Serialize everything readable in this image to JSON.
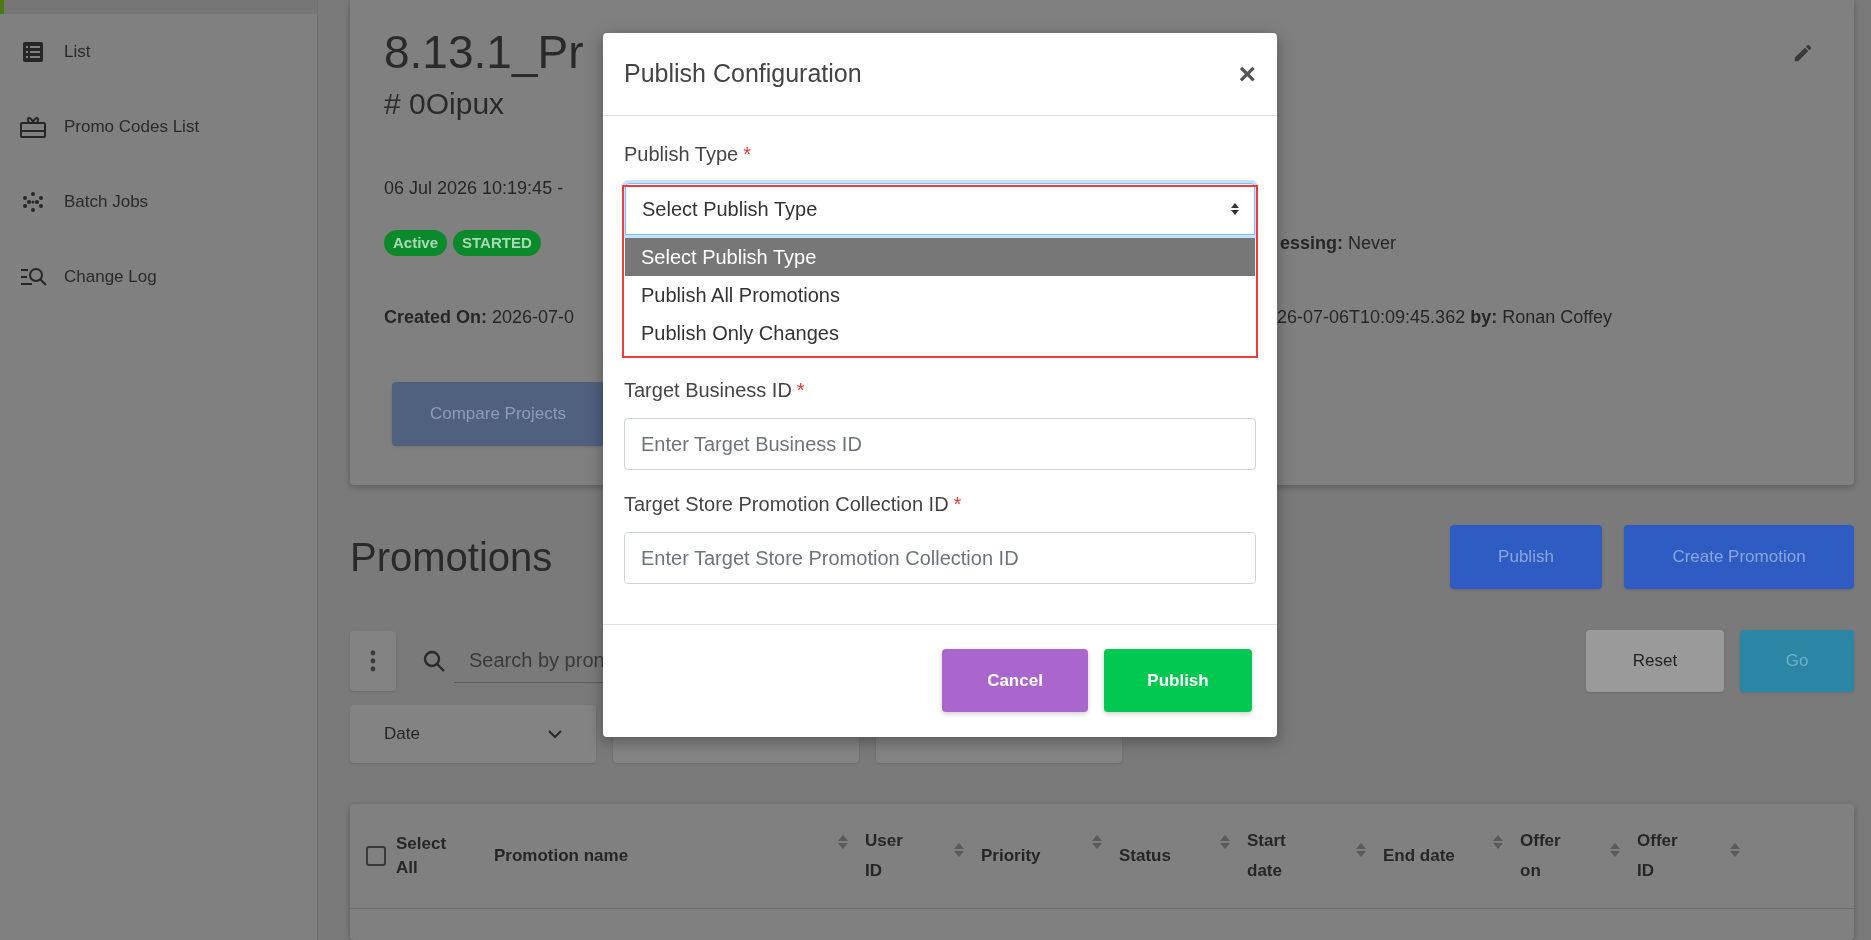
{
  "sidebar": {
    "items": [
      {
        "selected": true
      },
      {
        "label": "List",
        "selected": false
      },
      {
        "label": "Promo Codes List",
        "selected": false
      },
      {
        "label": "Batch Jobs",
        "selected": false
      },
      {
        "label": "Change Log",
        "selected": false
      }
    ]
  },
  "project": {
    "title": "8.13.1_Pr",
    "code": "# 0Oipux",
    "date": "06 Jul 2026 10:19:45 -",
    "badges": [
      {
        "label": "Active"
      },
      {
        "label": "STARTED"
      }
    ],
    "processing": {
      "label": "essing:",
      "value": "Never"
    },
    "created": {
      "label": "Created On:",
      "value": "2026-07-0"
    },
    "updated": {
      "value": "26-07-06T10:09:45.362",
      "by_label": "by:",
      "by": "Ronan Coffey"
    },
    "compare_button": "Compare Projects"
  },
  "promotions": {
    "heading": "Promotions",
    "buttons": [
      "Publish",
      "Create Promotion"
    ],
    "search_placeholder": "Search by pron",
    "reset": "Reset",
    "go": "Go",
    "filters": [
      {
        "kind": "labeled",
        "label": "Date"
      },
      {
        "kind": "covered"
      },
      {
        "kind": "covered"
      }
    ]
  },
  "table": {
    "select_all": {
      "label": "Select All",
      "checked": false
    },
    "columns": [
      {
        "label": "Promotion name"
      },
      {
        "label": "User ID"
      },
      {
        "label": "Priority"
      },
      {
        "label": "Status"
      },
      {
        "label": "Start date"
      },
      {
        "label": "End date"
      },
      {
        "label": "Offer on"
      },
      {
        "label": "Offer ID"
      }
    ]
  },
  "modal": {
    "title": "Publish Configuration",
    "close": "×",
    "fields": [
      {
        "kind": "select",
        "label": "Publish Type",
        "required_mark": "*",
        "value": "Select Publish Type",
        "expanded": true,
        "highlighted": true,
        "options": [
          {
            "label": "Select Publish Type",
            "selected": true
          },
          {
            "label": "Publish All Promotions",
            "selected": false
          },
          {
            "label": "Publish Only Changes",
            "selected": false
          }
        ]
      },
      {
        "kind": "input",
        "label": "Target Business ID",
        "required_mark": "*",
        "placeholder": "Enter Target Business ID"
      },
      {
        "kind": "input",
        "label": "Target Store Promotion Collection ID",
        "required_mark": "*",
        "placeholder": "Enter Target Store Promotion Collection ID"
      }
    ],
    "buttons": [
      {
        "label": "Cancel",
        "kind": "secondary"
      },
      {
        "label": "Publish",
        "kind": "primary"
      }
    ]
  }
}
